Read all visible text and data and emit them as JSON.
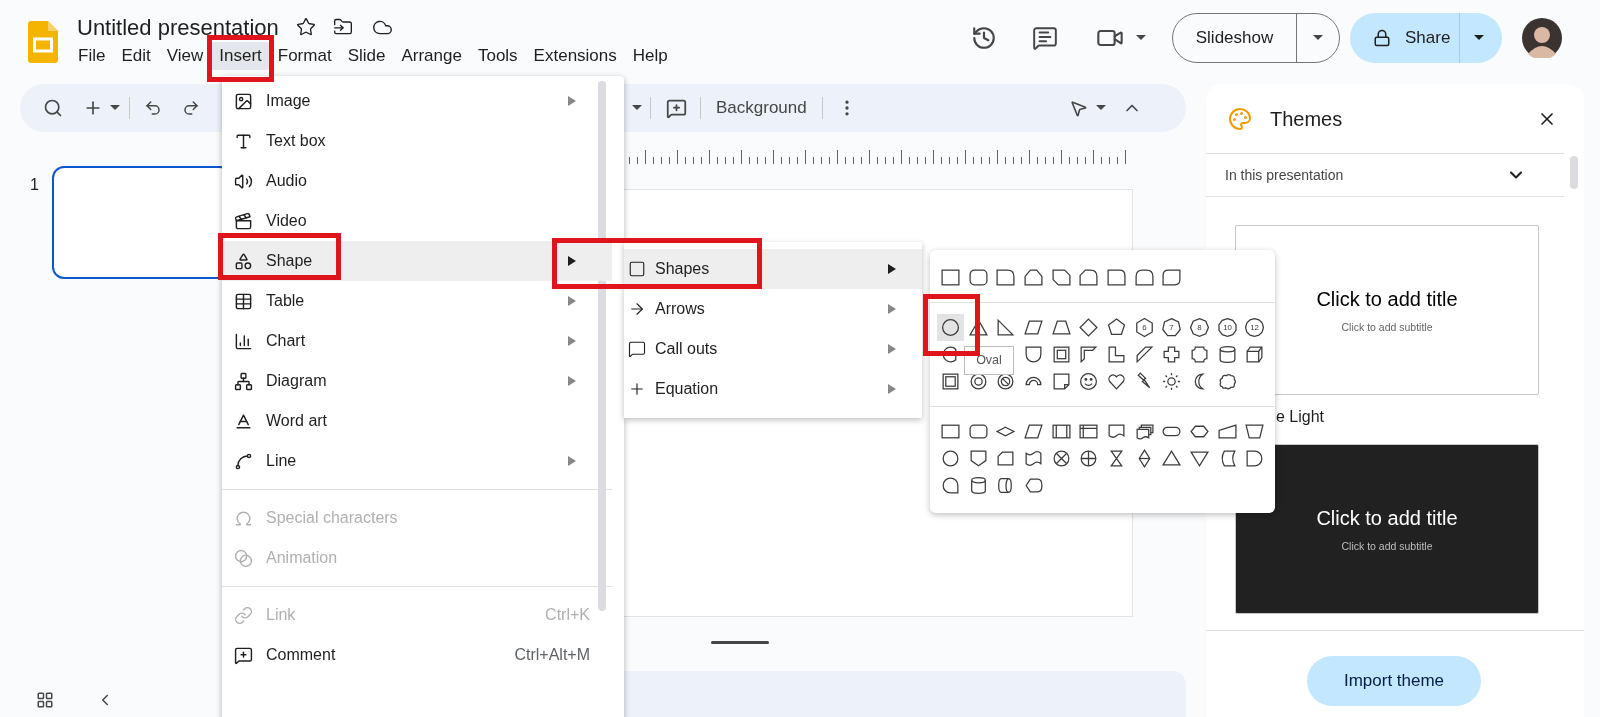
{
  "app": {
    "title": "Untitled presentation"
  },
  "menubar": [
    {
      "label": "File",
      "selected": false,
      "annotated": false
    },
    {
      "label": "Edit",
      "selected": false,
      "annotated": false
    },
    {
      "label": "View",
      "selected": false,
      "annotated": false
    },
    {
      "label": "Insert",
      "selected": true,
      "annotated": true
    },
    {
      "label": "Format",
      "selected": false,
      "annotated": false
    },
    {
      "label": "Slide",
      "selected": false,
      "annotated": false
    },
    {
      "label": "Arrange",
      "selected": false,
      "annotated": false
    },
    {
      "label": "Tools",
      "selected": false,
      "annotated": false
    },
    {
      "label": "Extensions",
      "selected": false,
      "annotated": false
    },
    {
      "label": "Help",
      "selected": false,
      "annotated": false
    }
  ],
  "header_buttons": {
    "slideshow": "Slideshow",
    "share": "Share"
  },
  "toolbar": {
    "background": "Background"
  },
  "filmstrip": {
    "slides": [
      {
        "number": "1",
        "selected": true
      }
    ]
  },
  "themes_panel": {
    "title": "Themes",
    "filter": "In this presentation",
    "themes": [
      {
        "kind": "light",
        "title": "Click to add title",
        "subtitle": "Click to add subtitle",
        "name": "e Light"
      },
      {
        "kind": "dark",
        "title": "Click to add title",
        "subtitle": "Click to add subtitle"
      }
    ],
    "import_button": "Import theme"
  },
  "insert_menu": {
    "sections": [
      [
        {
          "label": "Image",
          "has_submenu": true,
          "disabled": false,
          "selected": false,
          "annotated": false
        },
        {
          "label": "Text box",
          "has_submenu": false,
          "disabled": false,
          "selected": false,
          "annotated": false
        },
        {
          "label": "Audio",
          "has_submenu": false,
          "disabled": false,
          "selected": false,
          "annotated": false
        },
        {
          "label": "Video",
          "has_submenu": false,
          "disabled": false,
          "selected": false,
          "annotated": false
        },
        {
          "label": "Shape",
          "has_submenu": true,
          "disabled": false,
          "selected": true,
          "annotated": true
        },
        {
          "label": "Table",
          "has_submenu": true,
          "disabled": false,
          "selected": false,
          "annotated": false
        },
        {
          "label": "Chart",
          "has_submenu": true,
          "disabled": false,
          "selected": false,
          "annotated": false
        },
        {
          "label": "Diagram",
          "has_submenu": true,
          "disabled": false,
          "selected": false,
          "annotated": false
        },
        {
          "label": "Word art",
          "has_submenu": false,
          "disabled": false,
          "selected": false,
          "annotated": false
        },
        {
          "label": "Line",
          "has_submenu": true,
          "disabled": false,
          "selected": false,
          "annotated": false
        }
      ],
      [
        {
          "label": "Special characters",
          "has_submenu": false,
          "disabled": true,
          "selected": false,
          "annotated": false
        },
        {
          "label": "Animation",
          "has_submenu": false,
          "disabled": true,
          "selected": false,
          "annotated": false
        }
      ],
      [
        {
          "label": "Link",
          "shortcut": "Ctrl+K",
          "has_submenu": false,
          "disabled": true,
          "selected": false,
          "annotated": false
        },
        {
          "label": "Comment",
          "shortcut": "Ctrl+Alt+M",
          "has_submenu": false,
          "disabled": false,
          "selected": false,
          "annotated": false
        }
      ]
    ]
  },
  "shape_submenu": {
    "items": [
      {
        "label": "Shapes",
        "selected": true,
        "annotated": true
      },
      {
        "label": "Arrows",
        "selected": false,
        "annotated": false
      },
      {
        "label": "Call outs",
        "selected": false,
        "annotated": false
      },
      {
        "label": "Equation",
        "selected": false,
        "annotated": false
      }
    ]
  },
  "shape_palette": {
    "polygon_labels": [
      "6",
      "7",
      "8",
      "10",
      "12"
    ],
    "oval": {
      "hovered": true,
      "annotated": true,
      "tooltip": "Oval"
    }
  }
}
